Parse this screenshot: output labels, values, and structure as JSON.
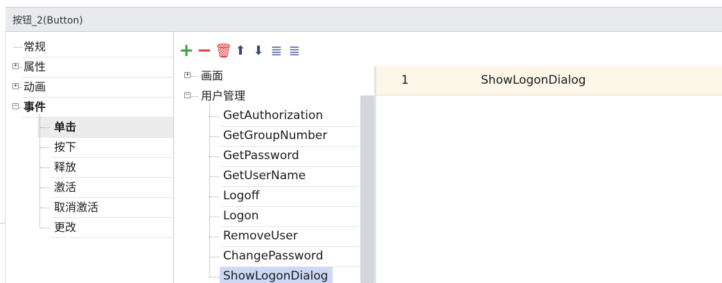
{
  "title": "按钮_2(Button)",
  "left_tree": [
    {
      "label": "常规",
      "expander": "",
      "bold": false,
      "indent": 0
    },
    {
      "label": "属性",
      "expander": "+",
      "bold": false,
      "indent": 0
    },
    {
      "label": "动画",
      "expander": "+",
      "bold": false,
      "indent": 0
    },
    {
      "label": "事件",
      "expander": "−",
      "bold": true,
      "indent": 0
    },
    {
      "label": "单击",
      "expander": "",
      "bold": true,
      "indent": 1,
      "selected": true
    },
    {
      "label": "按下",
      "expander": "",
      "bold": false,
      "indent": 1
    },
    {
      "label": "释放",
      "expander": "",
      "bold": false,
      "indent": 1
    },
    {
      "label": "激活",
      "expander": "",
      "bold": false,
      "indent": 1
    },
    {
      "label": "取消激活",
      "expander": "",
      "bold": false,
      "indent": 1
    },
    {
      "label": "更改",
      "expander": "",
      "bold": false,
      "indent": 1
    }
  ],
  "toolbar": [
    {
      "name": "add-icon",
      "glyph": "+",
      "color": "#3aa53a"
    },
    {
      "name": "remove-icon",
      "glyph": "−",
      "color": "#e03a3a"
    },
    {
      "name": "delete-icon",
      "glyph": "🗑",
      "color": "#e03a3a"
    },
    {
      "name": "move-up-icon",
      "glyph": "⬆",
      "color": "#3a4a7a"
    },
    {
      "name": "move-down-icon",
      "glyph": "⬇",
      "color": "#3a4a7a"
    },
    {
      "name": "indent-icon",
      "glyph": "≣",
      "color": "#5a6ab0"
    },
    {
      "name": "outdent-icon",
      "glyph": "≣",
      "color": "#5a6ab0"
    }
  ],
  "mid_tree": [
    {
      "label": "画面",
      "expander": "+",
      "indent": 0
    },
    {
      "label": "用户管理",
      "expander": "−",
      "indent": 0
    },
    {
      "label": "GetAuthorization",
      "expander": "",
      "indent": 1
    },
    {
      "label": "GetGroupNumber",
      "expander": "",
      "indent": 1
    },
    {
      "label": "GetPassword",
      "expander": "",
      "indent": 1
    },
    {
      "label": "GetUserName",
      "expander": "",
      "indent": 1
    },
    {
      "label": "Logoff",
      "expander": "",
      "indent": 1
    },
    {
      "label": "Logon",
      "expander": "",
      "indent": 1
    },
    {
      "label": "RemoveUser",
      "expander": "",
      "indent": 1
    },
    {
      "label": "ChangePassword",
      "expander": "",
      "indent": 1
    },
    {
      "label": "ShowLogonDialog",
      "expander": "",
      "indent": 1,
      "selected": true
    }
  ],
  "function_list": [
    {
      "index": "1",
      "name": "ShowLogonDialog"
    }
  ]
}
